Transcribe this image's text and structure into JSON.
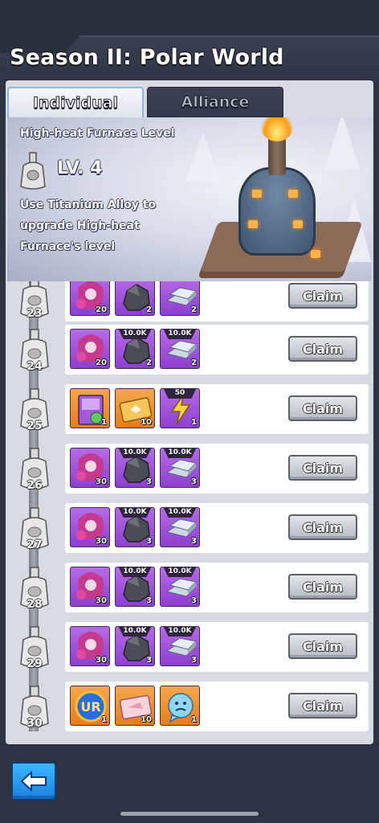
{
  "title": "Season II: Polar World",
  "tabs": {
    "individual": "Individual",
    "alliance": "Alliance"
  },
  "banner": {
    "label": "High-heat Furnace Level",
    "level": "LV. 4",
    "description": "Use Titanium Alloy to upgrade High-heat Furnace's level"
  },
  "rows": [
    {
      "level": "23",
      "rewards": [
        {
          "icon": "hero-portrait-icon",
          "count": "20",
          "tag": ""
        },
        {
          "icon": "coal-icon",
          "count": "2",
          "tag": ""
        },
        {
          "icon": "iron-ingot-icon",
          "count": "2",
          "tag": ""
        }
      ],
      "claim": "Claim"
    },
    {
      "level": "24",
      "rewards": [
        {
          "icon": "hero-portrait-icon",
          "count": "20",
          "tag": ""
        },
        {
          "icon": "coal-icon",
          "count": "2",
          "tag": "10.0K"
        },
        {
          "icon": "iron-ingot-icon",
          "count": "2",
          "tag": "10.0K"
        }
      ],
      "claim": "Claim"
    },
    {
      "level": "25",
      "rewards": [
        {
          "icon": "skill-book-icon",
          "count": "1",
          "tag": ""
        },
        {
          "icon": "ticket-icon",
          "count": "10",
          "tag": ""
        },
        {
          "icon": "lightning-icon",
          "count": "1",
          "tag": "50"
        }
      ],
      "claim": "Claim"
    },
    {
      "level": "26",
      "rewards": [
        {
          "icon": "hero-portrait-icon",
          "count": "30",
          "tag": ""
        },
        {
          "icon": "coal-icon",
          "count": "3",
          "tag": "10.0K"
        },
        {
          "icon": "iron-ingot-icon",
          "count": "3",
          "tag": "10.0K"
        }
      ],
      "claim": "Claim"
    },
    {
      "level": "27",
      "rewards": [
        {
          "icon": "hero-portrait-icon",
          "count": "30",
          "tag": ""
        },
        {
          "icon": "coal-icon",
          "count": "3",
          "tag": "10.0K"
        },
        {
          "icon": "iron-ingot-icon",
          "count": "3",
          "tag": "10.0K"
        }
      ],
      "claim": "Claim"
    },
    {
      "level": "28",
      "rewards": [
        {
          "icon": "hero-portrait-icon",
          "count": "30",
          "tag": ""
        },
        {
          "icon": "coal-icon",
          "count": "3",
          "tag": "10.0K"
        },
        {
          "icon": "iron-ingot-icon",
          "count": "3",
          "tag": "10.0K"
        }
      ],
      "claim": "Claim"
    },
    {
      "level": "29",
      "rewards": [
        {
          "icon": "hero-portrait-icon",
          "count": "30",
          "tag": ""
        },
        {
          "icon": "coal-icon",
          "count": "3",
          "tag": "10.0K"
        },
        {
          "icon": "iron-ingot-icon",
          "count": "3",
          "tag": "10.0K"
        }
      ],
      "claim": "Claim"
    },
    {
      "level": "30",
      "rewards": [
        {
          "icon": "ur-badge-icon",
          "count": "1",
          "tag": ""
        },
        {
          "icon": "pink-ticket-icon",
          "count": "10",
          "tag": ""
        },
        {
          "icon": "emote-bubble-icon",
          "count": "1",
          "tag": ""
        }
      ],
      "claim": "Claim"
    }
  ],
  "colors": {
    "accent": "#2a93f0",
    "panel": "#d8dbe3",
    "purple": "#9a4ed8",
    "orange": "#ee9233"
  }
}
